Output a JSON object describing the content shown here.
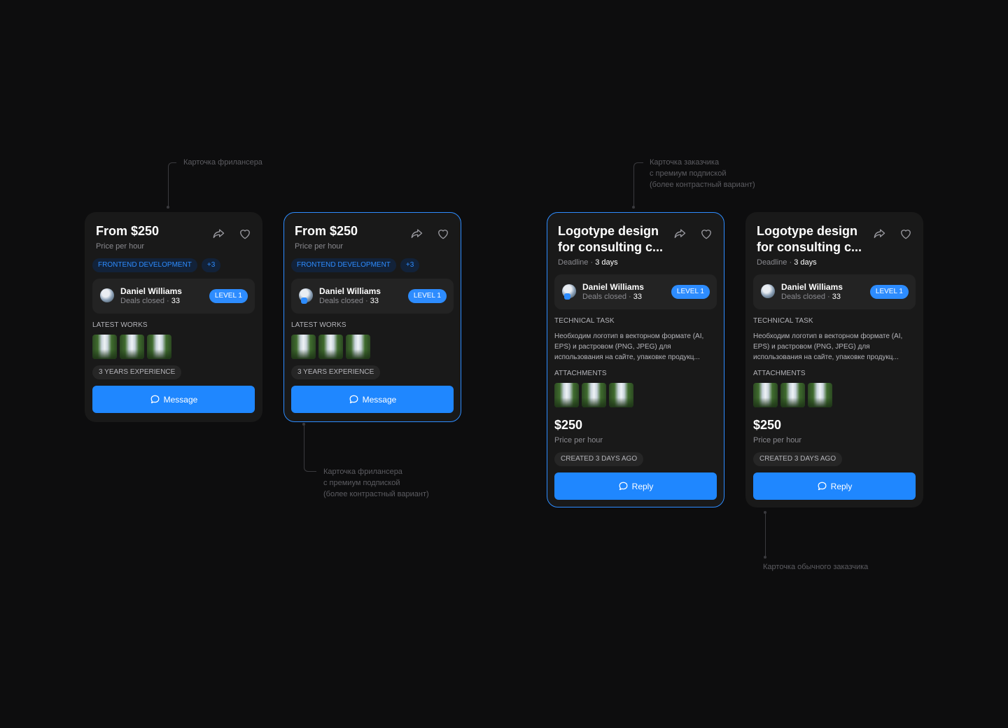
{
  "annotations": {
    "freelancer": "Карточка фрилансера",
    "freelancer_premium": [
      "Карточка фрилансера",
      "с премиум подпиской",
      "(более контрастный вариант)"
    ],
    "client_premium": [
      "Карточка заказчика",
      "с премиум подпиской",
      "(более контрастный вариант)"
    ],
    "client_regular": "Карточка обычного заказчика"
  },
  "freelancer_cards": [
    {
      "title": "From $250",
      "subtitle": "Price per hour",
      "tag": "FRONTEND DEVELOPMENT",
      "tag_more": "+3",
      "user_name": "Daniel Williams",
      "deals_label": "Deals closed ·",
      "deals_value": "33",
      "level": "LEVEL 1",
      "works_label": "LATEST WORKS",
      "experience": "3 YEARS EXPERIENCE",
      "cta": "Message"
    },
    {
      "title": "From $250",
      "subtitle": "Price per hour",
      "tag": "FRONTEND DEVELOPMENT",
      "tag_more": "+3",
      "user_name": "Daniel Williams",
      "deals_label": "Deals closed ·",
      "deals_value": "33",
      "level": "LEVEL 1",
      "works_label": "LATEST WORKS",
      "experience": "3 YEARS EXPERIENCE",
      "cta": "Message"
    }
  ],
  "client_cards": [
    {
      "title": "Logotype design for consulting c...",
      "deadline_label": "Deadline ·",
      "deadline_value": "3 days",
      "user_name": "Daniel Williams",
      "deals_label": "Deals closed ·",
      "deals_value": "33",
      "level": "LEVEL 1",
      "task_label": "TECHNICAL TASK",
      "task_text": "Необходим логотип в векторном формате (AI, EPS) и растровом (PNG, JPEG) для использования на сайте, упаковке продукц...",
      "attachments_label": "ATTACHMENTS",
      "price": "$250",
      "price_sub": "Price per hour",
      "created": "CREATED 3 DAYS AGO",
      "cta": "Reply"
    },
    {
      "title": "Logotype design for consulting c...",
      "deadline_label": "Deadline ·",
      "deadline_value": "3 days",
      "user_name": "Daniel Williams",
      "deals_label": "Deals closed ·",
      "deals_value": "33",
      "level": "LEVEL 1",
      "task_label": "TECHNICAL TASK",
      "task_text": "Необходим логотип в векторном формате (AI, EPS) и растровом (PNG, JPEG) для использования на сайте, упаковке продукц...",
      "attachments_label": "ATTACHMENTS",
      "price": "$250",
      "price_sub": "Price per hour",
      "created": "CREATED 3 DAYS AGO",
      "cta": "Reply"
    }
  ],
  "colors": {
    "accent": "#1f87ff",
    "card_bg": "#191919",
    "page_bg": "#0d0d0e"
  },
  "icons": [
    "share-icon",
    "heart-icon",
    "chat-bubble-icon",
    "verified-badge-icon"
  ]
}
